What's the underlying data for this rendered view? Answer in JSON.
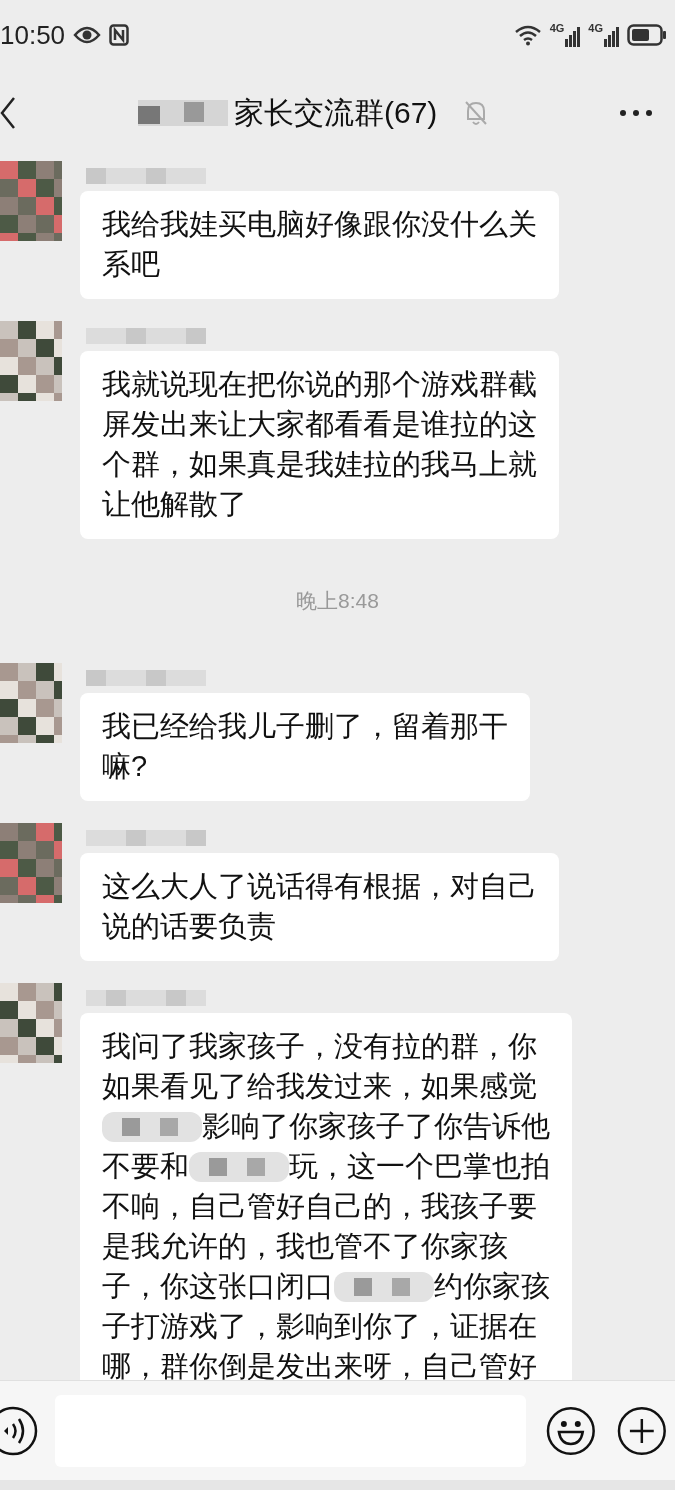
{
  "status_bar": {
    "time": "10:50",
    "sims": [
      {
        "network": "4G"
      },
      {
        "network": "4G"
      }
    ]
  },
  "header": {
    "title": "家长交流群(67)",
    "muted": true
  },
  "messages": [
    {
      "kind": "message",
      "lines": [
        [
          {
            "kind": "text",
            "text": "我给我娃买电脑好像跟你没什么关"
          }
        ],
        [
          {
            "kind": "text",
            "text": "系吧"
          }
        ]
      ]
    },
    {
      "kind": "message",
      "lines": [
        [
          {
            "kind": "text",
            "text": "我就说现在把你说的那个游戏群截"
          }
        ],
        [
          {
            "kind": "text",
            "text": "屏发出来让大家都看看是谁拉的这"
          }
        ],
        [
          {
            "kind": "text",
            "text": "个群，如果真是我娃拉的我马上就"
          }
        ],
        [
          {
            "kind": "text",
            "text": "让他解散了"
          }
        ]
      ]
    },
    {
      "kind": "time",
      "text": "晚上8:48"
    },
    {
      "kind": "message",
      "lines": [
        [
          {
            "kind": "text",
            "text": "我已经给我儿子删了，留着那干"
          }
        ],
        [
          {
            "kind": "text",
            "text": "嘛?"
          }
        ]
      ]
    },
    {
      "kind": "message",
      "lines": [
        [
          {
            "kind": "text",
            "text": "这么大人了说话得有根据，对自己"
          }
        ],
        [
          {
            "kind": "text",
            "text": "说的话要负责"
          }
        ]
      ]
    },
    {
      "kind": "message",
      "lines": [
        [
          {
            "kind": "text",
            "text": "我问了我家孩子，没有拉的群，你"
          }
        ],
        [
          {
            "kind": "text",
            "text": "如果看见了给我发过来，如果感觉"
          }
        ],
        [
          {
            "kind": "blur"
          },
          {
            "kind": "text",
            "text": "影响了你家孩子了你告诉他"
          }
        ],
        [
          {
            "kind": "text",
            "text": "不要和"
          },
          {
            "kind": "blur"
          },
          {
            "kind": "text",
            "text": "玩，这一个巴掌也拍"
          }
        ],
        [
          {
            "kind": "text",
            "text": "不响，自己管好自己的，我孩子要"
          }
        ],
        [
          {
            "kind": "text",
            "text": "是我允许的，我也管不了你家孩"
          }
        ],
        [
          {
            "kind": "text",
            "text": "子，你这张口闭口"
          },
          {
            "kind": "blur"
          },
          {
            "kind": "text",
            "text": "约你家孩"
          }
        ],
        [
          {
            "kind": "text",
            "text": "子打游戏了，影响到你了，证据在"
          }
        ],
        [
          {
            "kind": "text",
            "text": "哪，群你倒是发出来呀，自己管好"
          }
        ]
      ]
    }
  ]
}
